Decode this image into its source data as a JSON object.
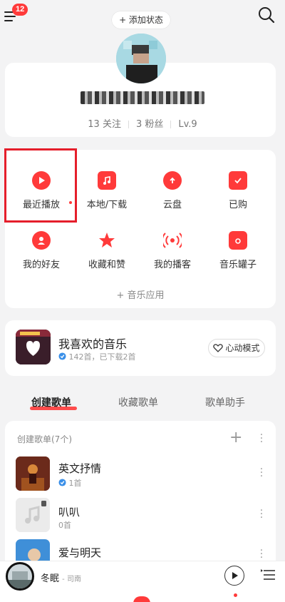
{
  "header": {
    "notification_count": "12",
    "add_status_label": "+ 添加状态"
  },
  "profile": {
    "username": "■■■■■■■■■■■",
    "follow_label": "13 关注",
    "fans_label": "3 粉丝",
    "level_label": "Lv.9"
  },
  "functions": {
    "recent": "最近播放",
    "local": "本地/下载",
    "cloud": "云盘",
    "purchased": "已购",
    "friends": "我的好友",
    "collections": "收藏和赞",
    "podcasts": "我的播客",
    "music_jar": "音乐罐子",
    "music_apps": "+ 音乐应用"
  },
  "favorite": {
    "title": "我喜欢的音乐",
    "subtitle": "142首，已下载2首",
    "mode_button": "心动模式"
  },
  "tabs": [
    "创建歌单",
    "收藏歌单",
    "歌单助手"
  ],
  "playlists": {
    "header": "创建歌单(7个)",
    "items": [
      {
        "name": "英文抒情",
        "count": "1首"
      },
      {
        "name": "叭叭",
        "count": "0首"
      },
      {
        "name": "爱与明天",
        "count": ""
      }
    ]
  },
  "player": {
    "song": "冬眠",
    "artist": "司南"
  },
  "colors": {
    "accent": "#ff3a3a",
    "highlight": "#e51e2b"
  }
}
